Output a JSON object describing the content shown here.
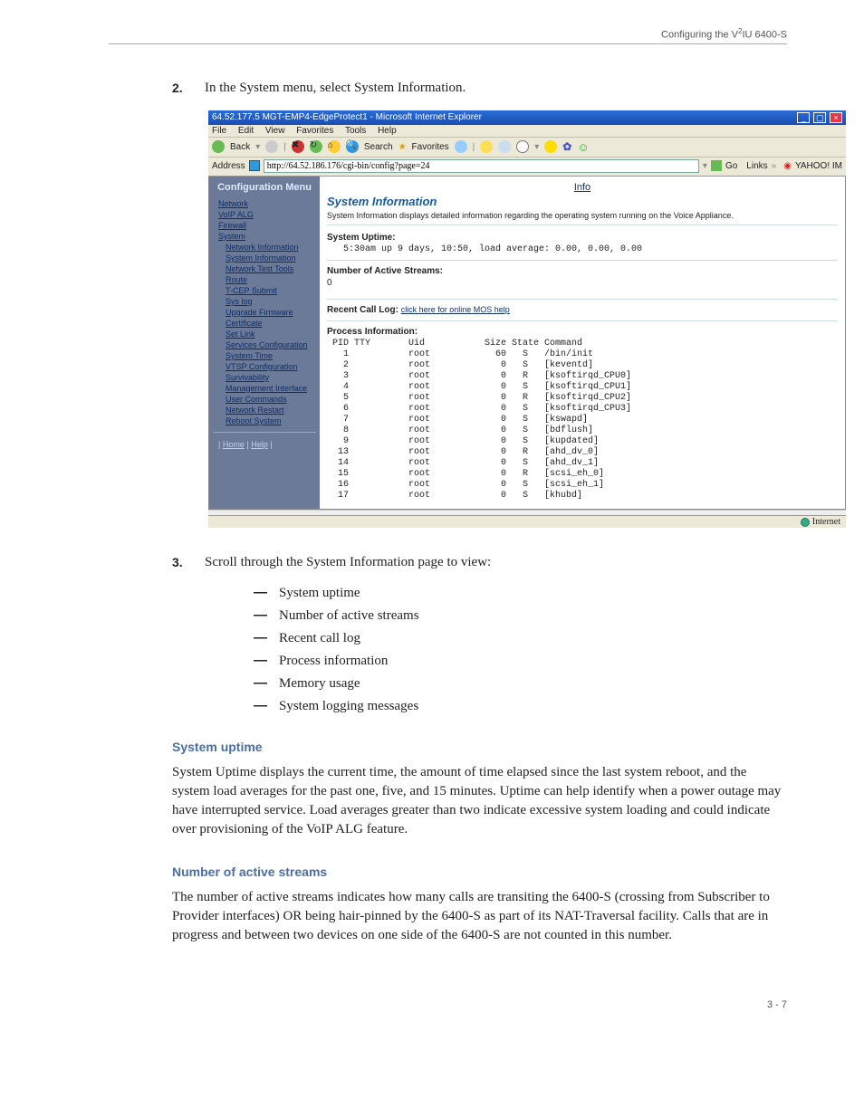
{
  "header": {
    "text_pre": "Configuring the V",
    "text_sup": "2",
    "text_post": "IU 6400-S"
  },
  "steps": {
    "s2_num": "2.",
    "s2_text": "In the System menu, select System Information.",
    "s3_num": "3.",
    "s3_text": "Scroll through the System Information page to view:",
    "bullets": [
      "System uptime",
      "Number of active streams",
      "Recent call log",
      "Process information",
      "Memory usage",
      "System logging messages"
    ]
  },
  "sections": {
    "uptime_h": "System uptime",
    "uptime_p": "System Uptime displays the current time, the amount of time elapsed since the last system reboot, and the system load averages for the past one, five, and 15 minutes. Uptime can help identify when a power outage may have interrupted service. Load averages greater than two indicate excessive system loading and could indicate over provisioning of the VoIP ALG feature.",
    "streams_h": "Number of active streams",
    "streams_p": "The number of active streams indicates how many calls are transiting the 6400-S (crossing from Subscriber to Provider interfaces) OR being hair-pinned by the 6400-S as part of its NAT-Traversal facility.  Calls that are in progress and between two devices on one side of the 6400-S are not counted in this number."
  },
  "footer": {
    "page": "3 - 7"
  },
  "shot": {
    "titlebar": "64.52.177.5 MGT-EMP4-EdgeProtect1 - Microsoft Internet Explorer",
    "menu": [
      "File",
      "Edit",
      "View",
      "Favorites",
      "Tools",
      "Help"
    ],
    "toolbar": {
      "back": "Back",
      "search": "Search",
      "fav": "Favorites"
    },
    "addr_label": "Address",
    "addr_value": "http://64.52.186.176/cgi-bin/config?page=24",
    "go": "Go",
    "links": "Links",
    "yahoo": "YAHOO!  IM",
    "nav_title": "Configuration Menu",
    "nav": {
      "main": [
        "Network",
        "VoIP ALG",
        "Firewall",
        "System"
      ],
      "sys": [
        "Network Information",
        "System Information",
        "Network Test Tools",
        "Route",
        "T-CEP Submit",
        "Sys log",
        "Upgrade Firmware",
        "Certificate",
        "Set Link"
      ],
      "rest": [
        "Services Configuration",
        "System Time",
        "VTSP Configuration",
        "Survivability",
        "Management Interface",
        "User Commands",
        "Network Restart",
        "Reboot System"
      ],
      "foot_home": "Home",
      "foot_help": "Help"
    },
    "main": {
      "info": "Info",
      "title": "System Information",
      "desc": "System Information displays detailed information regarding the operating system running on the Voice Appliance.",
      "uptime_label": "System Uptime:",
      "uptime_val": "5:30am  up 9 days, 10:50, load average: 0.00, 0.00, 0.00",
      "active_label": "Number of Active Streams:",
      "active_val": "0",
      "recent_label": "Recent Call Log:",
      "recent_link": "click here for online MOS help",
      "proc_label": "Process Information:",
      "proc_header": " PID TTY       Uid           Size State Command",
      "proc_rows": [
        "   1           root            60   S   /bin/init",
        "   2           root             0   S   [keventd]",
        "   3           root             0   R   [ksoftirqd_CPU0]",
        "   4           root             0   S   [ksoftirqd_CPU1]",
        "   5           root             0   R   [ksoftirqd_CPU2]",
        "   6           root             0   S   [ksoftirqd_CPU3]",
        "   7           root             0   S   [kswapd]",
        "   8           root             0   S   [bdflush]",
        "   9           root             0   S   [kupdated]",
        "  13           root             0   R   [ahd_dv_0]",
        "  14           root             0   S   [ahd_dv_1]",
        "  15           root             0   R   [scsi_eh_0]",
        "  16           root             0   S   [scsi_eh_1]",
        "  17           root             0   S   [khubd]"
      ]
    },
    "status": "Internet"
  }
}
